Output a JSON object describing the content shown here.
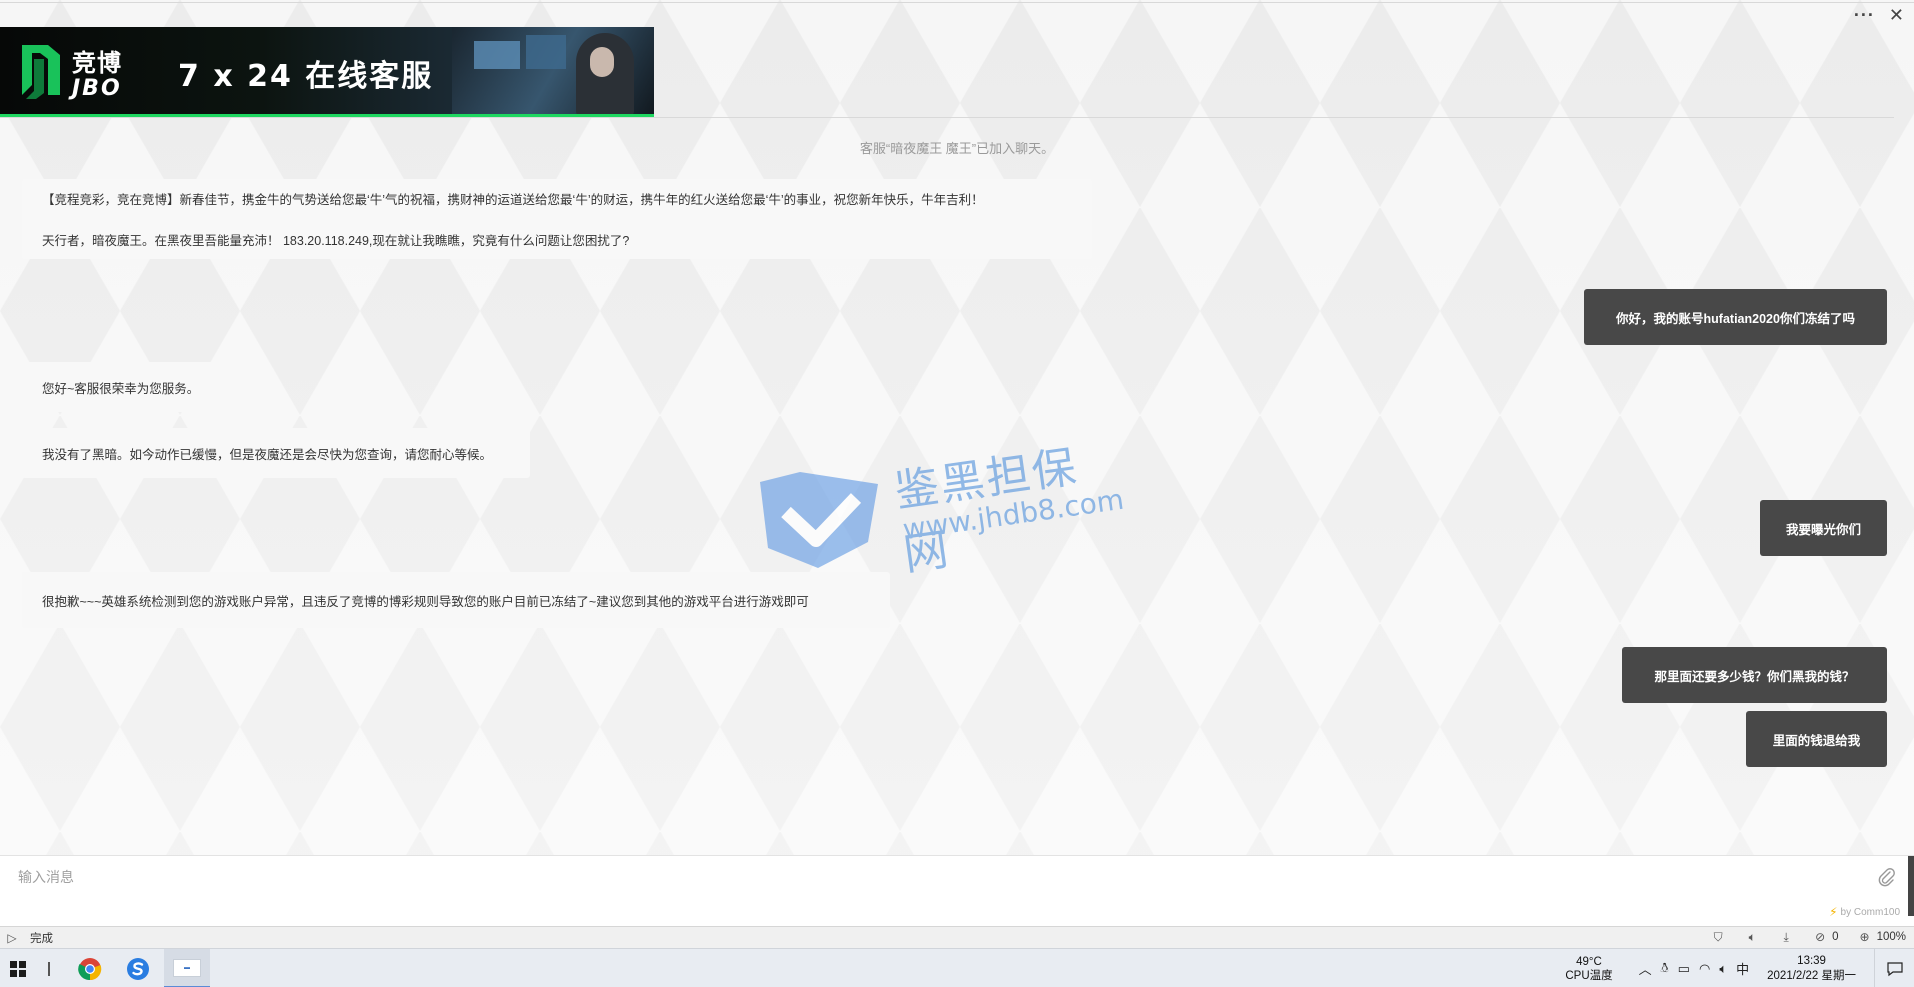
{
  "window": {
    "controls": {
      "more": "···",
      "close": "✕"
    }
  },
  "banner": {
    "brand_cn": "竞博",
    "brand_en": "JBO",
    "title": "7 x 24 在线客服"
  },
  "chat": {
    "system_message": "客服“暗夜魔王 魔王”已加入聊天。",
    "welcome": {
      "line1": "【竞程竞彩，竞在竞博】新春佳节，携金牛的气势送给您最‘牛’气的祝福，携财神的运道送给您最‘牛’的财运，携牛年的红火送给您最‘牛’的事业，祝您新年快乐，牛年吉利！",
      "line2": "天行者，暗夜魔王。在黑夜里吾能量充沛！ 183.20.118.249,现在就让我瞧瞧，究竟有什么问题让您困扰了?"
    },
    "messages": [
      {
        "from": "user",
        "text": "你好，我的账号hufatian2020你们冻结了吗"
      },
      {
        "from": "agent",
        "text": "您好~客服很荣幸为您服务。"
      },
      {
        "from": "agent",
        "text": "我没有了黑暗。如今动作已缓慢，但是夜魔还是会尽快为您查询，请您耐心等候。"
      },
      {
        "from": "user",
        "text": "我要曝光你们"
      },
      {
        "from": "agent",
        "text": "很抱歉~~~英雄系统检测到您的游戏账户异常，且违反了竞博的博彩规则导致您的账户目前已冻结了~建议您到其他的游戏平台进行游戏即可"
      },
      {
        "from": "user",
        "text": "那里面还要多少钱？你们黑我的钱？"
      },
      {
        "from": "user",
        "text": "里面的钱退给我"
      }
    ]
  },
  "watermark": {
    "cn": "鉴黑担保网",
    "url": "www.jhdb8.com"
  },
  "input": {
    "placeholder": "输入消息",
    "value": "",
    "powered_by": "by Comm100"
  },
  "statusbar": {
    "status": "完成",
    "blocked_count": "0",
    "zoom": "100%"
  },
  "taskbar": {
    "cpu_temp": "49°C",
    "cpu_label": "CPU温度",
    "ime": "中",
    "time": "13:39",
    "date": "2021/2/22 星期一"
  }
}
